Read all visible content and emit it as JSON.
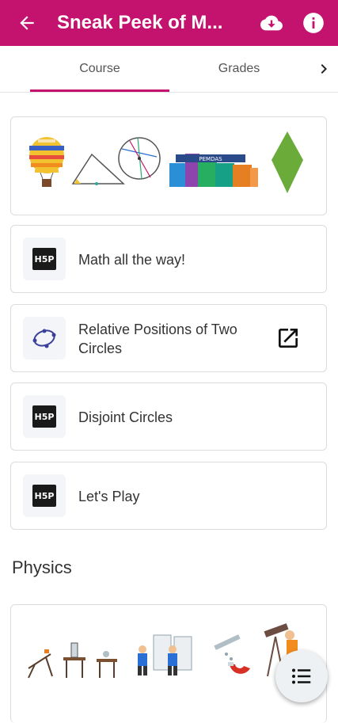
{
  "header": {
    "title": "Sneak Peek of M...",
    "back_icon": "arrow-left-icon",
    "download_icon": "cloud-download-icon",
    "info_icon": "info-icon",
    "bar_color": "#c4136f"
  },
  "tabs": [
    {
      "label": "Course",
      "active": true
    },
    {
      "label": "Grades",
      "active": false
    }
  ],
  "items": [
    {
      "label": "Math all the way!",
      "icon": "h5p-icon"
    },
    {
      "label": "Relative Positions of Two Circles",
      "line1": "Relative Positions of Two",
      "line2": "Circles",
      "icon": "circle-geometry-icon",
      "action_icon": "open-external-icon"
    },
    {
      "label": "Disjoint Circles",
      "icon": "h5p-icon"
    },
    {
      "label": "Let's Play",
      "icon": "h5p-icon"
    }
  ],
  "h5p_text": "H5P",
  "section": {
    "title": "Physics"
  },
  "pemdas_text": "PEMDAS"
}
